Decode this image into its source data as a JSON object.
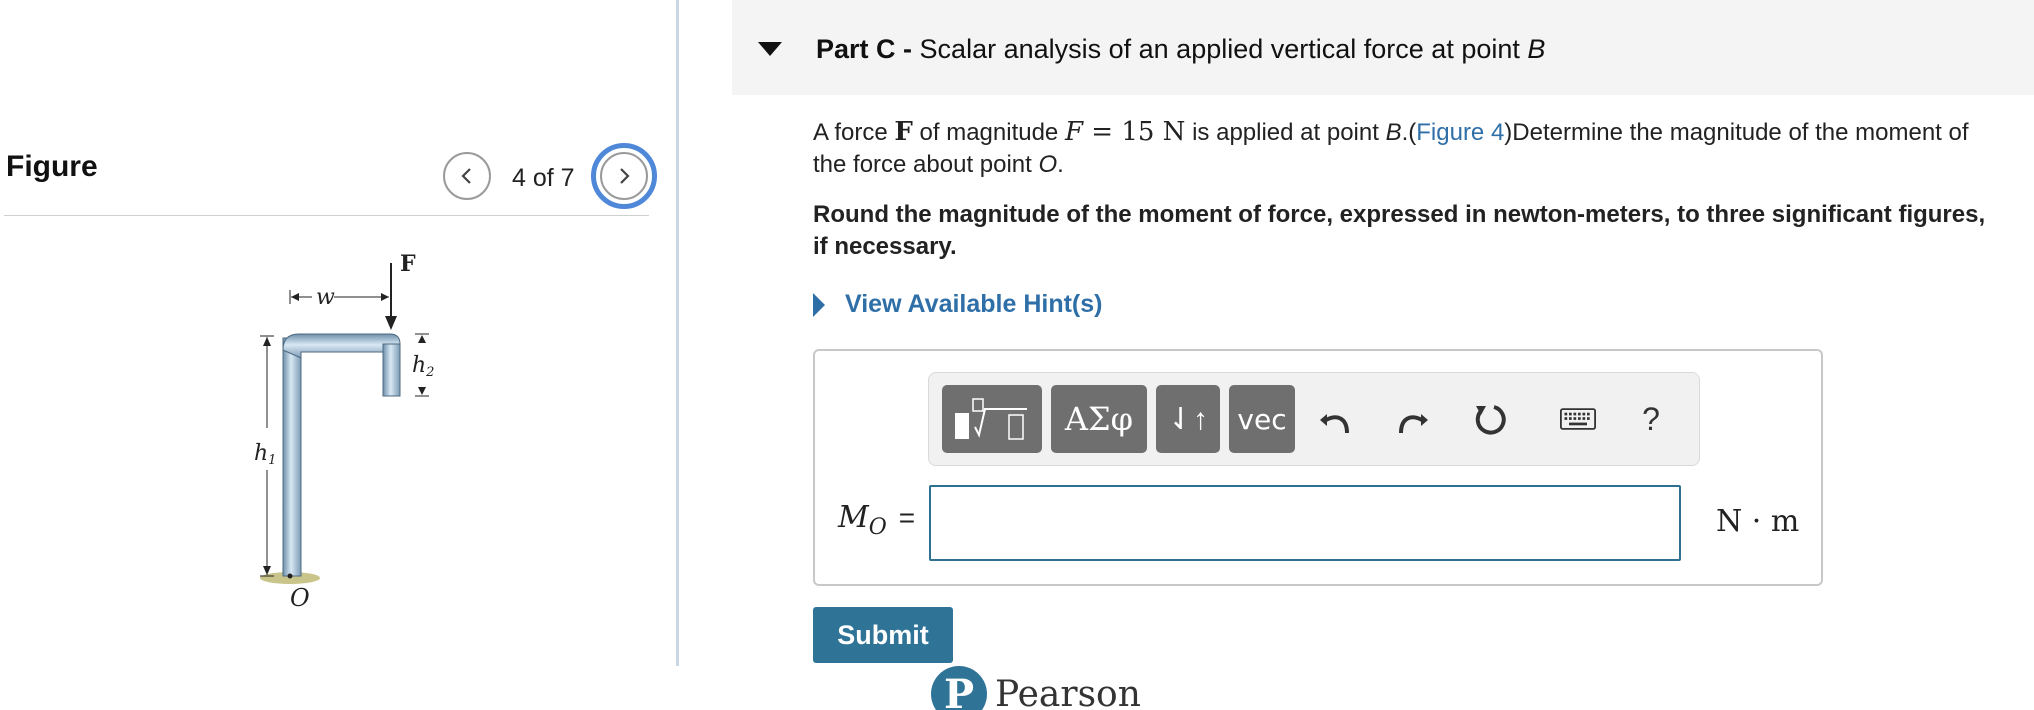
{
  "figure_panel": {
    "title": "Figure",
    "counter": "4 of 7",
    "labels": {
      "force": "F",
      "width": "w",
      "height1": "h",
      "height1_sub": "1",
      "height2": "h",
      "height2_sub": "2",
      "origin": "O"
    }
  },
  "part": {
    "label": "Part C -",
    "title": "Scalar analysis of an applied vertical force at point ",
    "title_point": "B"
  },
  "question": {
    "t1": "A force ",
    "force_symbol": "F",
    "t2": " of magnitude ",
    "mag_symbol": "F",
    "mag_value": " = 15 N",
    "t3": " is applied at point ",
    "point_b": "B",
    "t4": ".(",
    "figure_link": "Figure 4",
    "t5": ")Determine the magnitude of the moment of the force about point ",
    "point_o": "O",
    "t6": "."
  },
  "instruction": "Round the magnitude of the moment of force, expressed in newton-meters, to three significant figures, if necessary.",
  "hint_label": "View Available Hint(s)",
  "toolbar": {
    "greek_label": "ΑΣφ",
    "arrows_label": "⇃↑",
    "vec_label": "vec",
    "help_label": "?"
  },
  "answer": {
    "var": "M",
    "var_sub": "O",
    "equals": "=",
    "value": "",
    "unit": "N · m"
  },
  "submit_label": "Submit",
  "footer": {
    "logo_letter": "P",
    "brand": "Pearson"
  },
  "colors": {
    "accent": "#2f7497",
    "link": "#2f6fa8",
    "focus_ring": "#4f88d8",
    "toolbar_button": "#6f6f6f"
  }
}
